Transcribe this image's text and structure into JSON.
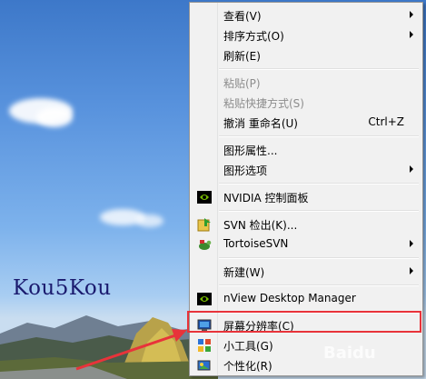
{
  "watermark": "Kou5Kou",
  "baidu_mark": "Baidu",
  "colors": {
    "highlight": "#e8333a",
    "menu_bg": "#f1f1f1",
    "nvidia": "#76b900"
  },
  "menu": {
    "view": "查看(V)",
    "sort": "排序方式(O)",
    "refresh": "刷新(E)",
    "paste": "粘贴(P)",
    "paste_shortcut": "粘贴快捷方式(S)",
    "undo": "撤消 重命名(U)",
    "undo_key": "Ctrl+Z",
    "graphics_props": "图形属性...",
    "graphics_options": "图形选项",
    "nvidia": "NVIDIA 控制面板",
    "svn_checkout": "SVN 检出(K)...",
    "tortoise": "TortoiseSVN",
    "new": "新建(W)",
    "nview": "nView Desktop Manager",
    "resolution": "屏幕分辨率(C)",
    "gadgets": "小工具(G)",
    "personalize": "个性化(R)"
  },
  "icons": [
    "nvidia-icon",
    "svn-checkout-icon",
    "tortoisesvn-icon",
    "nview-icon",
    "screen-resolution-icon",
    "gadgets-icon",
    "personalize-icon"
  ]
}
